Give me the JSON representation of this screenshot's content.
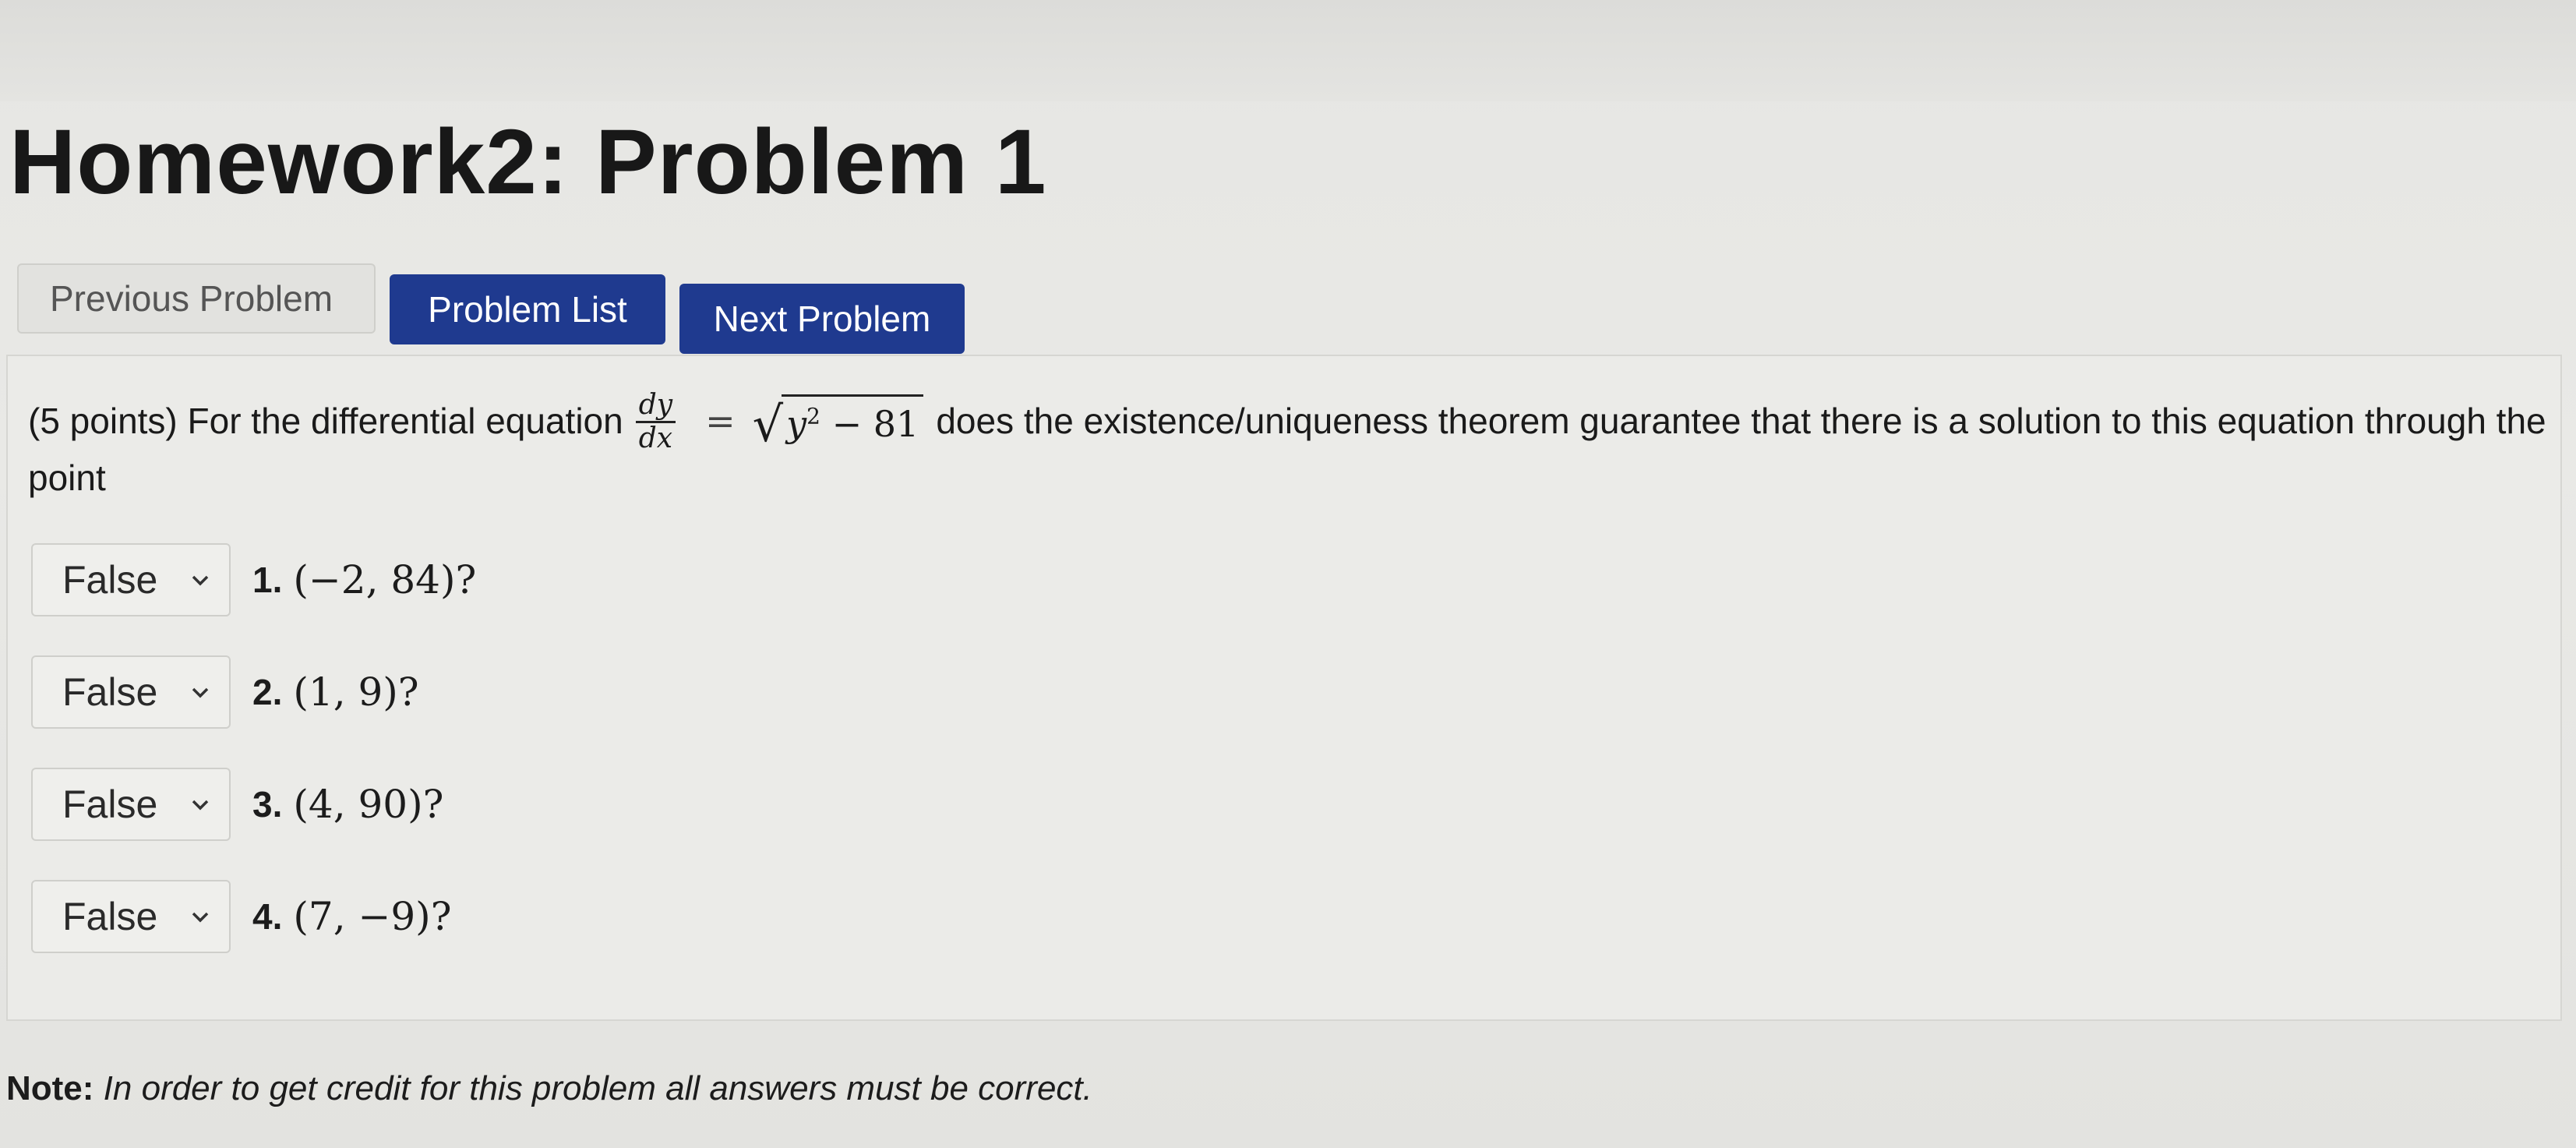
{
  "page": {
    "title": "Homework2: Problem 1"
  },
  "nav": {
    "previous_label": "Previous Problem",
    "list_label": "Problem List",
    "next_label": "Next Problem"
  },
  "question": {
    "prefix": "(5 points) For the differential equation",
    "frac_num": "dy",
    "frac_den": "dx",
    "equals": "=",
    "radicand_var": "y",
    "radicand_exp": "2",
    "radicand_rest": " − 81",
    "suffix": "does the existence/uniqueness theorem guarantee that there is a solution to this equation through the",
    "line2": "point"
  },
  "items": [
    {
      "selected": "False",
      "number": "1.",
      "point": "(−2, 84)?"
    },
    {
      "selected": "False",
      "number": "2.",
      "point": "(1, 9)?"
    },
    {
      "selected": "False",
      "number": "3.",
      "point": "(4, 90)?"
    },
    {
      "selected": "False",
      "number": "4.",
      "point": "(7, −9)?"
    }
  ],
  "note": {
    "label": "Note:",
    "text": "In order to get credit for this problem all answers must be correct."
  },
  "colors": {
    "button_primary": "#1f3a8f",
    "background": "#e8e8e5"
  }
}
